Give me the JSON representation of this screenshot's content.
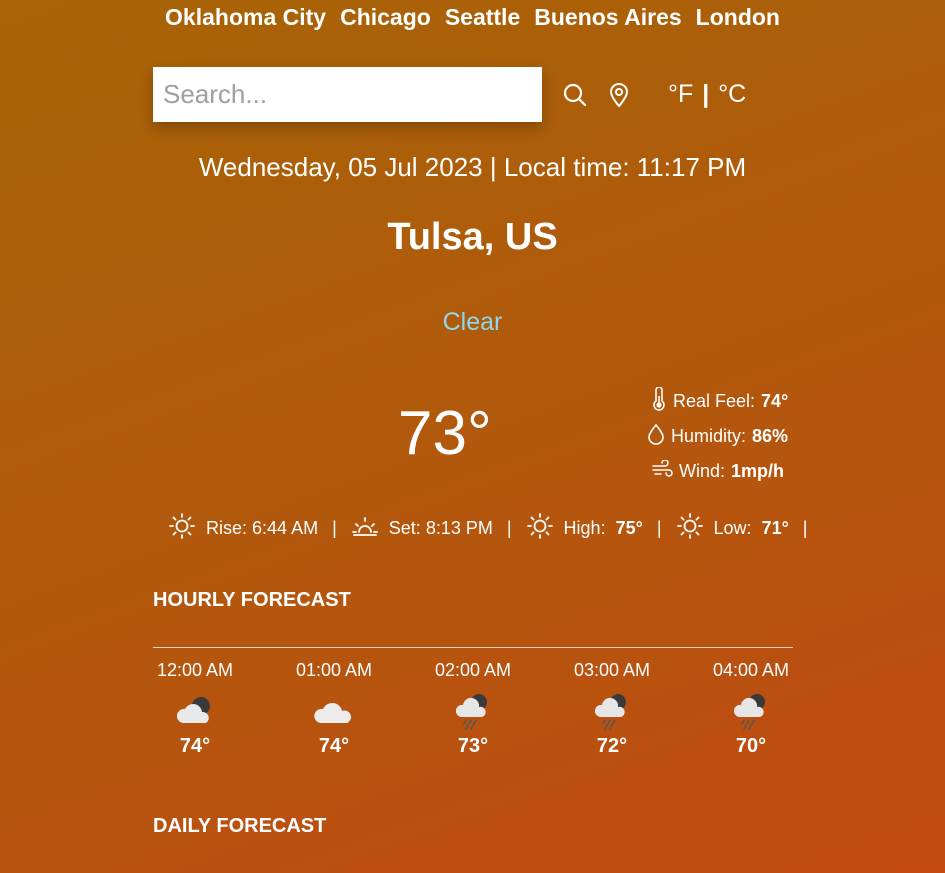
{
  "cities": [
    "Oklahoma City",
    "Chicago",
    "Seattle",
    "Buenos Aires",
    "London"
  ],
  "search": {
    "placeholder": "Search..."
  },
  "units": {
    "fahrenheit": "°F",
    "separator": "|",
    "celsius": "°C"
  },
  "datetime": "Wednesday, 05 Jul 2023 | Local time: 11:17 PM",
  "location": "Tulsa, US",
  "condition": "Clear",
  "temperature": "73°",
  "details": {
    "real_feel_label": "Real Feel:",
    "real_feel": "74°",
    "humidity_label": "Humidity:",
    "humidity": "86%",
    "wind_label": "Wind:",
    "wind": "1mp/h"
  },
  "sun": {
    "rise_label": "Rise:",
    "rise": "6:44 AM",
    "set_label": "Set:",
    "set": "8:13 PM",
    "high_label": "High:",
    "high": "75°",
    "low_label": "Low:",
    "low": "71°",
    "sep": "|"
  },
  "hourly_title": "HOURLY FORECAST",
  "hourly": [
    {
      "time": "12:00 AM",
      "icon": "cloud-moon-icon",
      "temp": "74°"
    },
    {
      "time": "01:00 AM",
      "icon": "cloud-icon",
      "temp": "74°"
    },
    {
      "time": "02:00 AM",
      "icon": "rain-cloud-icon",
      "temp": "73°"
    },
    {
      "time": "03:00 AM",
      "icon": "rain-cloud-icon",
      "temp": "72°"
    },
    {
      "time": "04:00 AM",
      "icon": "rain-cloud-icon",
      "temp": "70°"
    }
  ],
  "daily_title": "DAILY FORECAST",
  "colors": {
    "condition": "#8fd6ee",
    "bg_start": "#a86406",
    "bg_end": "#c14a12"
  }
}
